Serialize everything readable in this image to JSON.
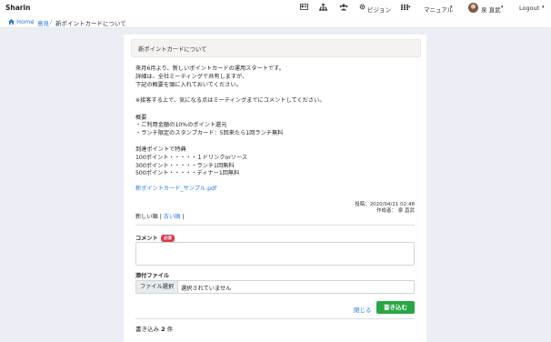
{
  "app": {
    "brand": "Sharin"
  },
  "nav": {
    "vision": "ビジョン",
    "manual": "マニュアル",
    "user": "泉 直武",
    "logout": "Logout"
  },
  "breadcrumb": [
    "Home",
    "意見",
    "新ポイントカードについて"
  ],
  "post": {
    "title": "新ポイントカードについて",
    "lines": [
      "来月6月より、新しいポイントカードの運用スタートです。",
      "詳細は、全社ミーティングで共有しますが、",
      "下記の概要を頭に入れておいてください。",
      "",
      "※接客する上で、気になる点はミーティングまでにコメントしてください。",
      "",
      "概要",
      "・ご利用金額の10%のポイント還元",
      "・ランチ限定のスタンプカード：5回来たら1回ランチ無料",
      "",
      "到達ポイントで特典",
      "100ポイント・・・・・１ドリンクorソース",
      "300ポイント・・・・・ランチ1回無料",
      "500ポイント・・・・・ディナー1回無料"
    ],
    "attachment": "新ポイントカード_サンプル.pdf",
    "posted_at": "投稿：2020/04/21 02:48",
    "author": "作成者： 泉 直武"
  },
  "sort": {
    "new": "新しい順",
    "old": "古い順"
  },
  "form": {
    "comment_label": "コメント",
    "required_badge": "必須",
    "file_label": "添付ファイル",
    "file_button": "ファイル選択",
    "file_status": "選択されていません",
    "close_label": "閉じる",
    "submit_label": "書き込む"
  },
  "comments": {
    "label": "書き込み",
    "count": "2",
    "unit": "件"
  }
}
